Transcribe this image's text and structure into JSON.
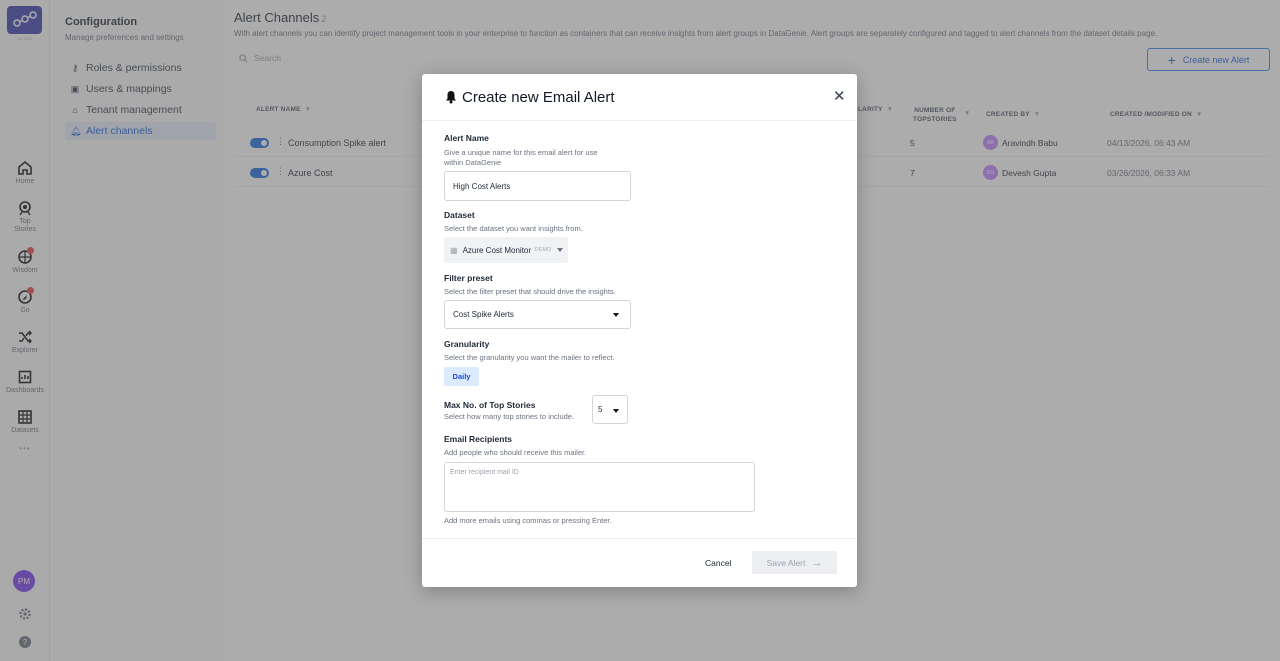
{
  "rail": {
    "logo_sub": "ALGO",
    "items": [
      {
        "label": "Home",
        "icon": "home-icon"
      },
      {
        "label": "Top Stories",
        "icon": "top-stories-icon"
      },
      {
        "label": "Wisdom",
        "icon": "wisdom-icon"
      },
      {
        "label": "Go",
        "icon": "go-icon"
      },
      {
        "label": "Explorer",
        "icon": "explorer-icon"
      },
      {
        "label": "Dashboards",
        "icon": "dashboards-icon"
      },
      {
        "label": "Datasets",
        "icon": "datasets-icon"
      }
    ],
    "more": "•••",
    "user_initials": "PM"
  },
  "config": {
    "title": "Configuration",
    "subtitle": "Manage preferences and settings",
    "items": [
      {
        "label": "Roles & permissions",
        "icon": "key-icon"
      },
      {
        "label": "Users & mappings",
        "icon": "users-icon"
      },
      {
        "label": "Tenant management",
        "icon": "home-icon"
      },
      {
        "label": "Alert channels",
        "icon": "bell-icon",
        "active": true
      }
    ]
  },
  "page": {
    "title": "Alert Channels",
    "count": "2",
    "description": "With alert channels you can identify project management tools in your enterprise to function as containers that can receive insights from alert groups in DataGenie. Alert groups are separately configured and tagged to alert channels from the dataset details page.",
    "search_placeholder": "Search",
    "create_label": "Create new Alert"
  },
  "table": {
    "headers": {
      "alert_name": "ALERT NAME",
      "granularity": "LARITY",
      "topstories_1": "NUMBER OF",
      "topstories_2": "TOPSTORIES",
      "created_by": "CREATED BY",
      "created_on": "CREATED /MODIFIED ON"
    },
    "rows": [
      {
        "name": "Consumption Spike alert",
        "topstories": "5",
        "initials": "AB",
        "created_by": "Aravindh Babu",
        "date": "04/13/2026, 06:43 AM"
      },
      {
        "name": "Azure Cost",
        "topstories": "7",
        "initials": "DG",
        "created_by": "Devesh Gupta",
        "date": "03/26/2026, 06:33 AM"
      }
    ]
  },
  "modal": {
    "title": "Create new Email Alert",
    "alert_name": {
      "label": "Alert Name",
      "hint_1": "Give a unique name for this email alert for use",
      "hint_2": "within DataGenie",
      "value": "High Cost Alerts"
    },
    "dataset": {
      "label": "Dataset",
      "hint": "Select the dataset you want insights from.",
      "value": "Azure Cost Monitor",
      "tag": "DEMO"
    },
    "filter": {
      "label": "Filter preset",
      "hint": "Select the filter preset that should drive the insights.",
      "value": "Cost Spike Alerts"
    },
    "granularity": {
      "label": "Granularity",
      "hint": "Select the granularity you want the mailer to reflect.",
      "value": "Daily"
    },
    "max_stories": {
      "label": "Max No. of Top Stories",
      "hint": "Select how many top stories to include.",
      "value": "5"
    },
    "recipients": {
      "label": "Email Recipients",
      "hint": "Add people who should receive this mailer.",
      "placeholder": "Enter recipient mail ID",
      "footer_hint": "Add more emails using commas or pressing Enter."
    },
    "cancel_label": "Cancel",
    "save_label": "Save Alert"
  },
  "colors": {
    "accent": "#1d6fe0",
    "brand": "#3a3fae",
    "avatar": "#7c3aed"
  }
}
